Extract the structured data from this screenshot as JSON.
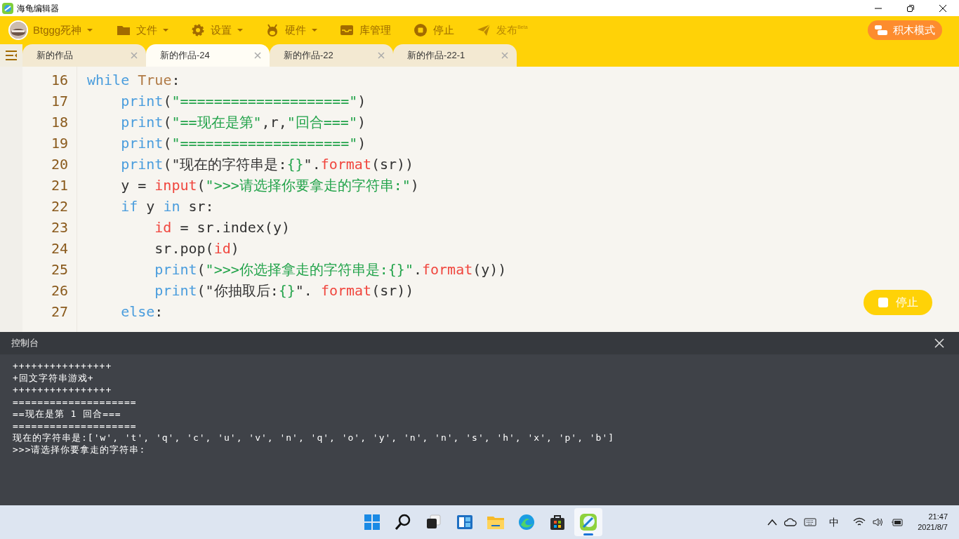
{
  "window": {
    "title": "海龟编辑器"
  },
  "toolbar": {
    "user": {
      "label": "Btggg死神"
    },
    "items": [
      {
        "kind": "folder",
        "label": "文件",
        "dropdown": true
      },
      {
        "kind": "gear",
        "label": "设置",
        "dropdown": true
      },
      {
        "kind": "robot",
        "label": "硬件",
        "dropdown": true
      },
      {
        "kind": "inbox",
        "label": "库管理",
        "dropdown": false
      },
      {
        "kind": "stop",
        "label": "停止",
        "dropdown": false
      },
      {
        "kind": "send",
        "label": "发布",
        "badge": "Beta",
        "dropdown": false
      }
    ],
    "mode_button": "积木模式"
  },
  "tabs": [
    {
      "label": "新的作品",
      "selected": false
    },
    {
      "label": "新的作品-24",
      "selected": true
    },
    {
      "label": "新的作品-22",
      "selected": false
    },
    {
      "label": "新的作品-22-1",
      "selected": false
    }
  ],
  "editor": {
    "lines": [
      {
        "number": "16",
        "tokens": [
          {
            "kind": "kw",
            "text": "while"
          },
          {
            "kind": "const",
            "text": " True"
          },
          {
            "kind": "plain",
            "text": ":"
          }
        ]
      },
      {
        "number": "17",
        "tokens": [
          {
            "kind": "kw",
            "text": "    print"
          },
          {
            "kind": "plain",
            "text": "("
          },
          {
            "kind": "str",
            "text": "\"====================\""
          },
          {
            "kind": "plain",
            "text": ")"
          }
        ]
      },
      {
        "number": "18",
        "tokens": [
          {
            "kind": "kw",
            "text": "    print"
          },
          {
            "kind": "plain",
            "text": "("
          },
          {
            "kind": "str",
            "text": "\"==现在是第\""
          },
          {
            "kind": "plain",
            "text": ",r,"
          },
          {
            "kind": "str",
            "text": "\"回合===\""
          },
          {
            "kind": "plain",
            "text": ")"
          }
        ]
      },
      {
        "number": "19",
        "tokens": [
          {
            "kind": "kw",
            "text": "    print"
          },
          {
            "kind": "plain",
            "text": "("
          },
          {
            "kind": "str",
            "text": "\"====================\""
          },
          {
            "kind": "plain",
            "text": ")"
          }
        ]
      },
      {
        "number": "20",
        "tokens": [
          {
            "kind": "kw",
            "text": "    print"
          },
          {
            "kind": "plain",
            "text": "(\"现在的字符串是:"
          },
          {
            "kind": "str",
            "text": "{}"
          },
          {
            "kind": "plain",
            "text": "\"."
          },
          {
            "kind": "fn",
            "text": "format"
          },
          {
            "kind": "plain",
            "text": "(sr))"
          }
        ]
      },
      {
        "number": "21",
        "tokens": [
          {
            "kind": "plain",
            "text": "    y = "
          },
          {
            "kind": "fn",
            "text": "input"
          },
          {
            "kind": "plain",
            "text": "("
          },
          {
            "kind": "str",
            "text": "\">>>请选择你要拿走的字符串:\""
          },
          {
            "kind": "plain",
            "text": ")"
          }
        ]
      },
      {
        "number": "22",
        "tokens": [
          {
            "kind": "kw",
            "text": "    if"
          },
          {
            "kind": "plain",
            "text": " y "
          },
          {
            "kind": "kw",
            "text": "in"
          },
          {
            "kind": "plain",
            "text": " sr:"
          }
        ]
      },
      {
        "number": "23",
        "tokens": [
          {
            "kind": "fn",
            "text": "        id"
          },
          {
            "kind": "plain",
            "text": " = sr.index(y)"
          }
        ]
      },
      {
        "number": "24",
        "tokens": [
          {
            "kind": "plain",
            "text": "        sr.pop("
          },
          {
            "kind": "fn",
            "text": "id"
          },
          {
            "kind": "plain",
            "text": ")"
          }
        ]
      },
      {
        "number": "25",
        "tokens": [
          {
            "kind": "kw",
            "text": "        print"
          },
          {
            "kind": "plain",
            "text": "("
          },
          {
            "kind": "str",
            "text": "\">>>你选择拿走的字符串是:{}\""
          },
          {
            "kind": "plain",
            "text": "."
          },
          {
            "kind": "fn",
            "text": "format"
          },
          {
            "kind": "plain",
            "text": "(y))"
          }
        ]
      },
      {
        "number": "26",
        "tokens": [
          {
            "kind": "kw",
            "text": "        print"
          },
          {
            "kind": "plain",
            "text": "(\"你抽取后:"
          },
          {
            "kind": "str",
            "text": "{}"
          },
          {
            "kind": "plain",
            "text": "\". "
          },
          {
            "kind": "fn",
            "text": "format"
          },
          {
            "kind": "plain",
            "text": "(sr))"
          }
        ]
      },
      {
        "number": "27",
        "tokens": [
          {
            "kind": "kw",
            "text": "    else"
          },
          {
            "kind": "plain",
            "text": ":"
          }
        ]
      }
    ]
  },
  "stop_button": "停止",
  "console": {
    "title": "控制台",
    "lines": [
      "++++++++++++++++",
      "+回文字符串游戏+",
      "++++++++++++++++",
      "====================",
      "==现在是第 1 回合===",
      "====================",
      "现在的字符串是:['w', 't', 'q', 'c', 'u', 'v', 'n', 'q', 'o', 'y', 'n', 'n', 's', 'h', 'x', 'p', 'b']",
      ">>>请选择你要拿走的字符串:"
    ]
  },
  "taskbar": {
    "apps": [
      {
        "kind": "start",
        "selected": false
      },
      {
        "kind": "search",
        "selected": false
      },
      {
        "kind": "taskview",
        "selected": false
      },
      {
        "kind": "widgets",
        "selected": false
      },
      {
        "kind": "explorer",
        "selected": false
      },
      {
        "kind": "browser",
        "selected": false
      },
      {
        "kind": "store",
        "selected": false
      },
      {
        "kind": "turtle",
        "selected": true
      }
    ],
    "ime": "中",
    "time": "21:47",
    "date": "2021/8/7"
  }
}
